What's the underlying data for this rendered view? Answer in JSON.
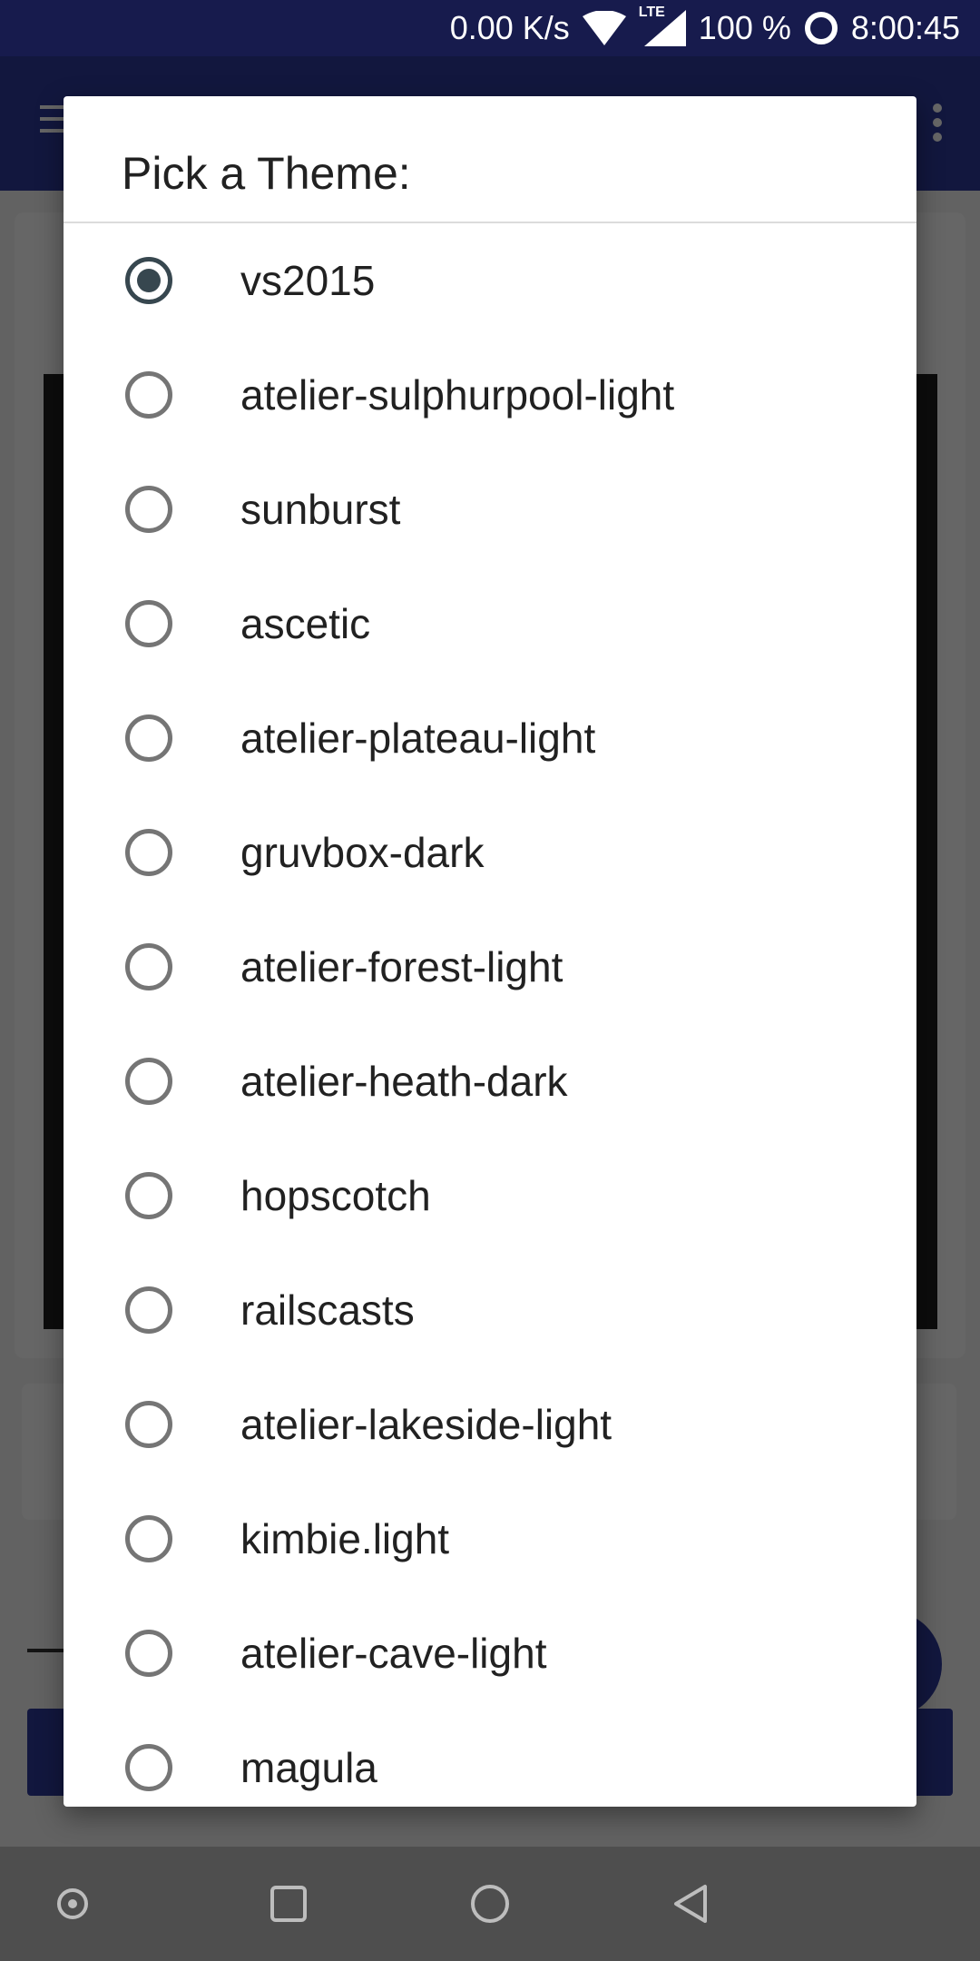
{
  "status_bar": {
    "net_speed": "0.00 K/s",
    "network_type": "LTE",
    "battery": "100 %",
    "time": "8:00:45",
    "icons": [
      "wifi-icon",
      "signal-icon",
      "battery-ring-icon"
    ]
  },
  "dialog": {
    "title": "Pick a Theme:",
    "selected": "vs2015",
    "options": [
      "vs2015",
      "atelier-sulphurpool-light",
      "sunburst",
      "ascetic",
      "atelier-plateau-light",
      "gruvbox-dark",
      "atelier-forest-light",
      "atelier-heath-dark",
      "hopscotch",
      "railscasts",
      "atelier-lakeside-light",
      "kimbie.light",
      "atelier-cave-light",
      "magula"
    ]
  },
  "nav_bar": {
    "icons": [
      "assist-icon",
      "recents-icon",
      "home-icon",
      "back-icon"
    ]
  },
  "colors": {
    "status_bar": "#171b4d",
    "toolbar": "#2f3b9c",
    "radio_checked": "#37474f",
    "radio_unchecked": "#757575"
  }
}
